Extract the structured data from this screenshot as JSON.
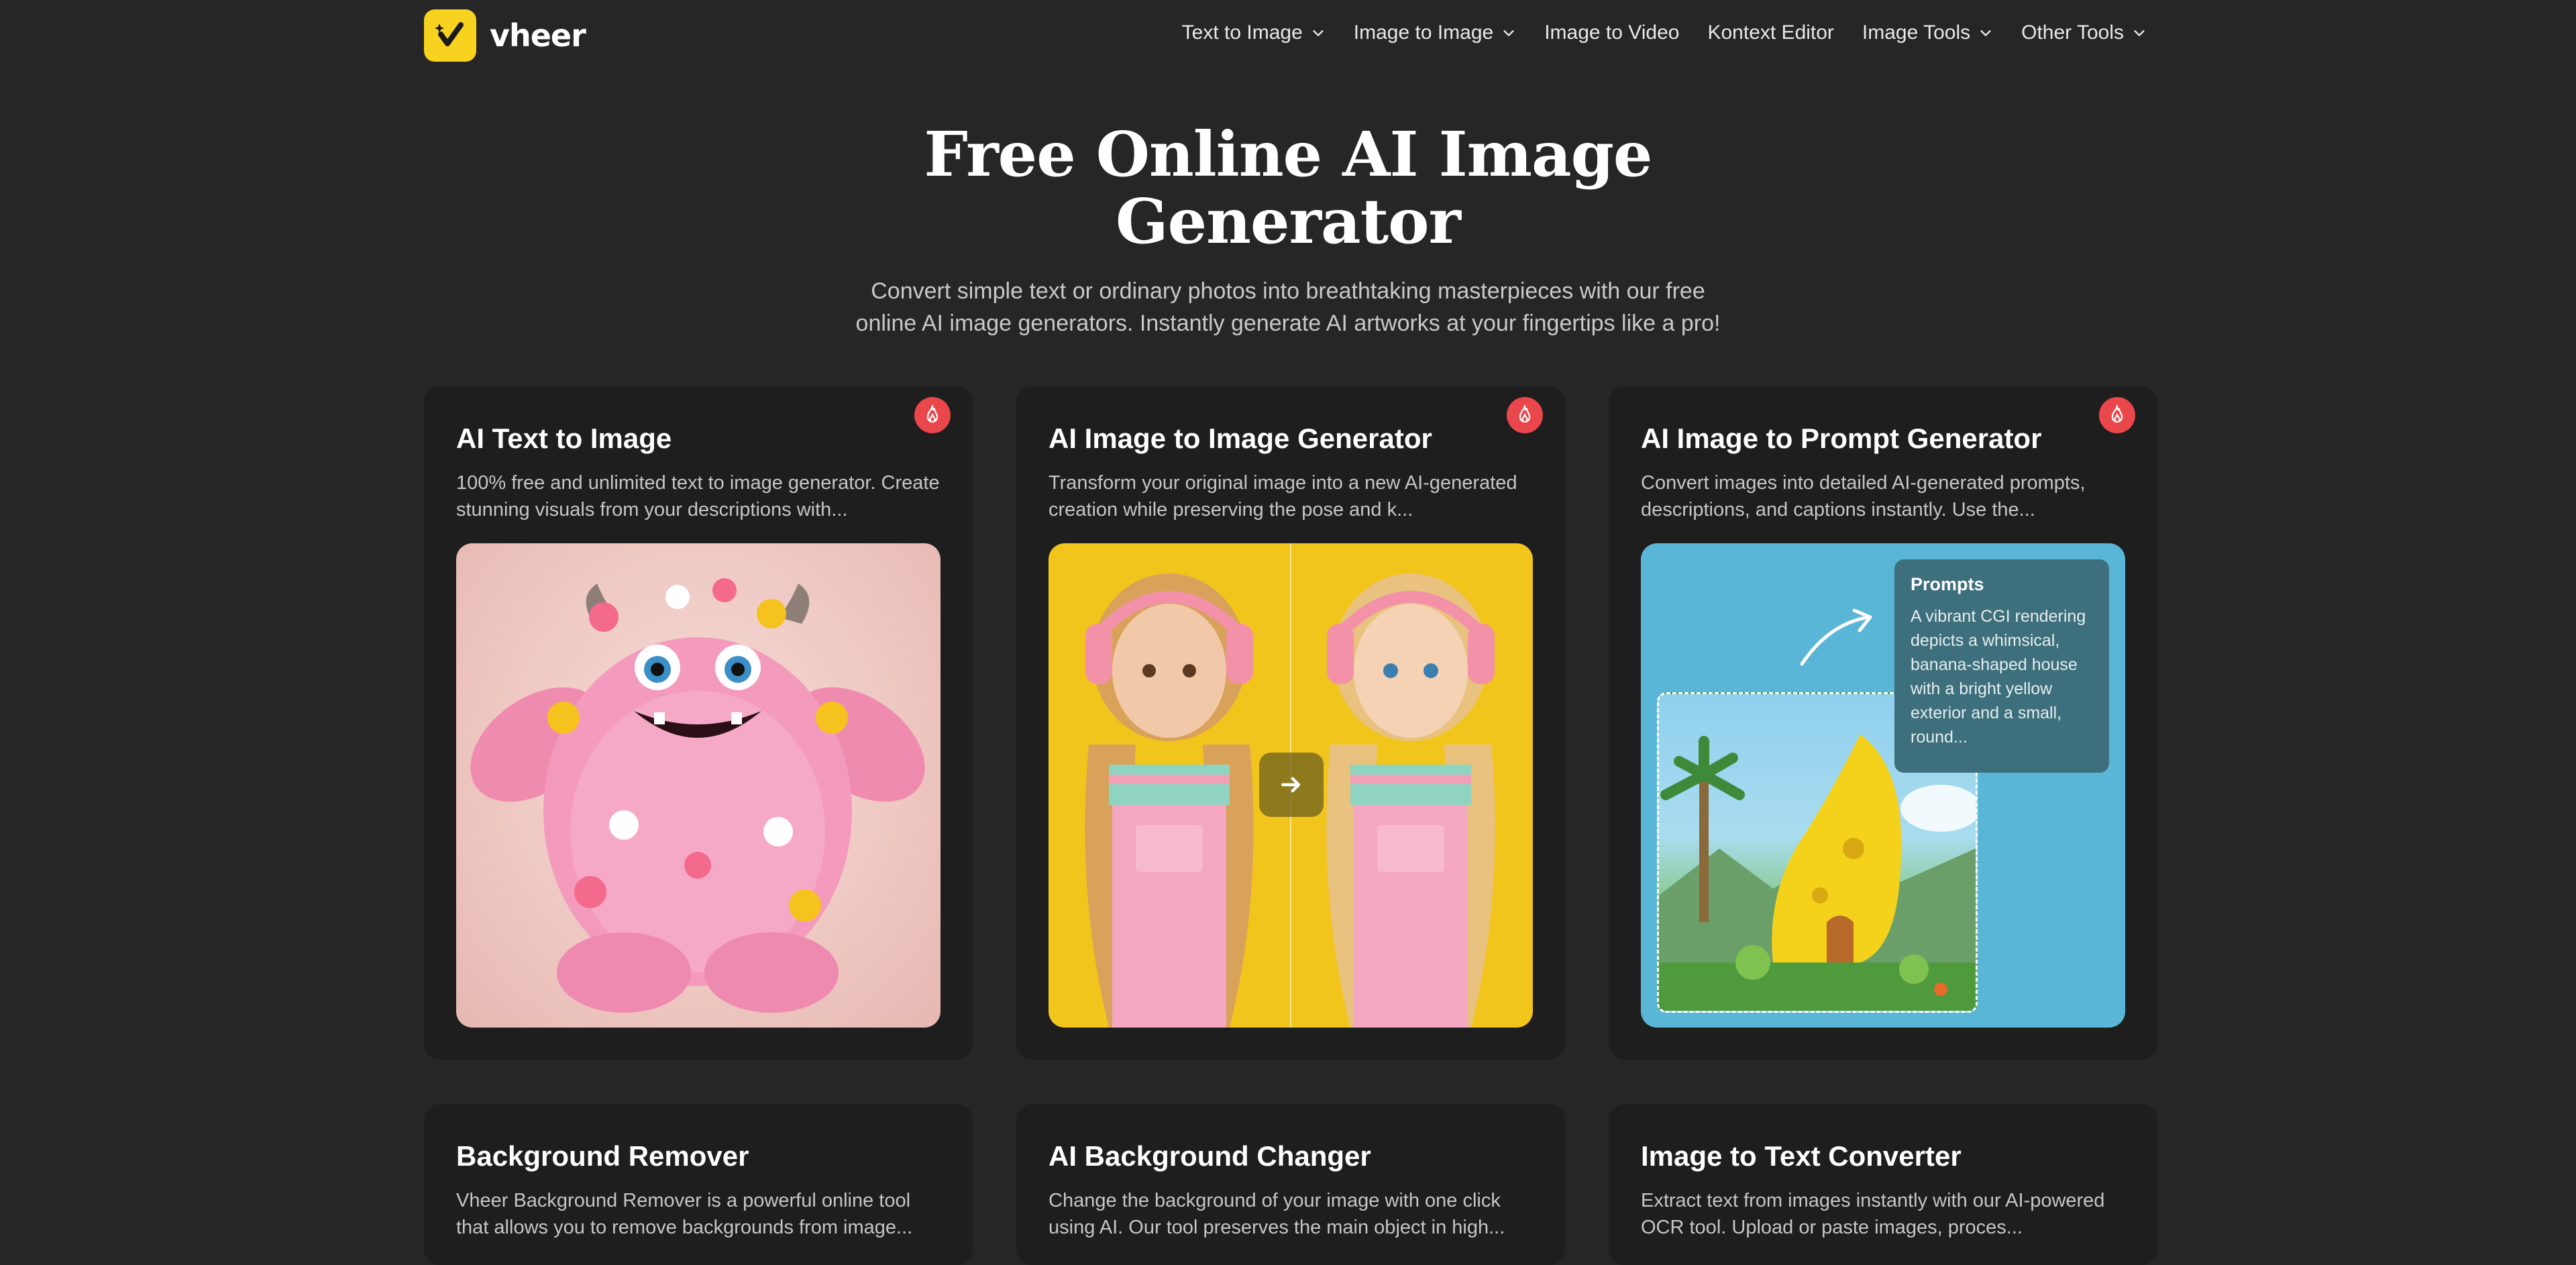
{
  "brand": {
    "name": "vheer",
    "color": "#f7d21e"
  },
  "nav": {
    "items": [
      {
        "label": "Text to Image",
        "dropdown": true
      },
      {
        "label": "Image to Image",
        "dropdown": true
      },
      {
        "label": "Image to Video",
        "dropdown": false
      },
      {
        "label": "Kontext Editor",
        "dropdown": false
      },
      {
        "label": "Image Tools",
        "dropdown": true
      },
      {
        "label": "Other Tools",
        "dropdown": true
      }
    ]
  },
  "hero": {
    "title": "Free Online AI Image Generator",
    "subtitle": "Convert simple text or ordinary photos into breathtaking masterpieces with our free online AI image generators. Instantly generate AI artworks at your fingertips like a pro!"
  },
  "cards": [
    {
      "title": "AI Text to Image",
      "description": "100% free and unlimited text to image generator. Create stunning visuals from your descriptions with...",
      "hot": true,
      "thumb": "pink-monster-image"
    },
    {
      "title": "AI Image to Image Generator",
      "description": "Transform your original image into a new AI-generated creation while preserving the pose and k...",
      "hot": true,
      "thumb": "girls-comparison-image"
    },
    {
      "title": "AI Image to Prompt Generator",
      "description": "Convert images into detailed AI-generated prompts, descriptions, and captions instantly. Use the...",
      "hot": true,
      "thumb": "banana-house-image",
      "prompt_title": "Prompts",
      "prompt_text": "A vibrant CGI rendering depicts a whimsical, banana-shaped house with a bright yellow exterior and a small, round..."
    },
    {
      "title": "Background Remover",
      "description": "Vheer Background Remover is a powerful online tool that allows you to remove backgrounds from image..."
    },
    {
      "title": "AI Background Changer",
      "description": "Change the background of your image with one click using AI. Our tool preserves the main object in high..."
    },
    {
      "title": "Image to Text Converter",
      "description": "Extract text from images instantly with our AI-powered OCR tool. Upload or paste images, proces..."
    }
  ],
  "colors": {
    "background": "#262626",
    "card": "#1e1e1e",
    "hot_badge": "#e9474c"
  },
  "icons": {
    "logo": "checkmark-sparkle-icon",
    "dropdown": "chevron-down-icon",
    "hot": "fire-icon",
    "compare": "arrow-right-icon"
  }
}
